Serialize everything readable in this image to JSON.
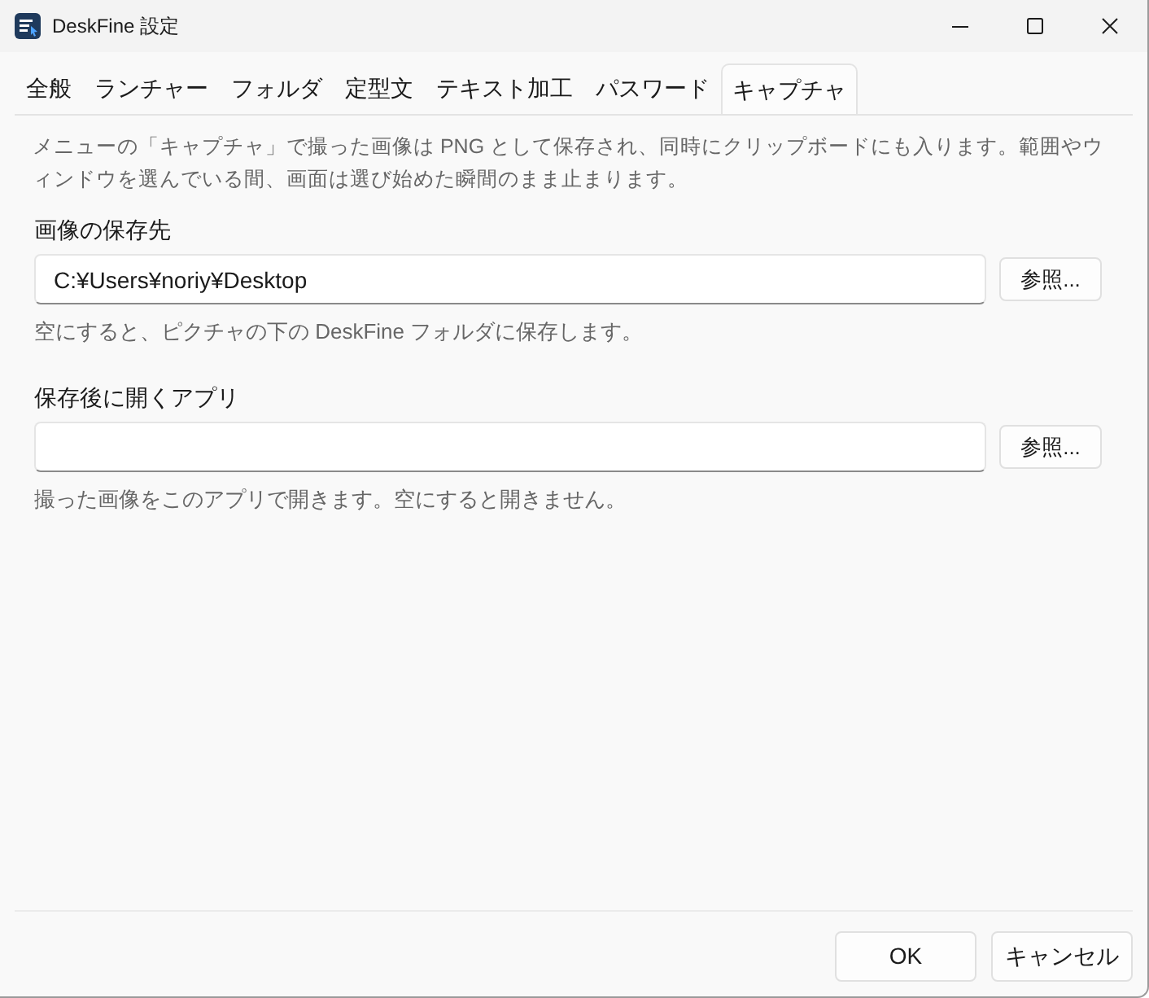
{
  "window": {
    "title": "DeskFine 設定"
  },
  "tabs": [
    {
      "label": "全般",
      "selected": false
    },
    {
      "label": "ランチャー",
      "selected": false
    },
    {
      "label": "フォルダ",
      "selected": false
    },
    {
      "label": "定型文",
      "selected": false
    },
    {
      "label": "テキスト加工",
      "selected": false
    },
    {
      "label": "パスワード",
      "selected": false
    },
    {
      "label": "キャプチャ",
      "selected": true
    }
  ],
  "description": "メニューの「キャプチャ」で撮った画像は PNG として保存され、同時にクリップボードにも入ります。範囲やウィンドウを選んでいる間、画面は選び始めた瞬間のまま止まります。",
  "fields": [
    {
      "label": "画像の保存先",
      "value": "C:¥Users¥noriy¥Desktop",
      "button": "参照...",
      "hint": "空にすると、ピクチャの下の DeskFine フォルダに保存します。"
    },
    {
      "label": "保存後に開くアプリ",
      "button": "参照...",
      "hint": "撮った画像をこのアプリで開きます。空にすると開きません。"
    }
  ],
  "buttons": [
    "OK",
    "キャンセル"
  ]
}
